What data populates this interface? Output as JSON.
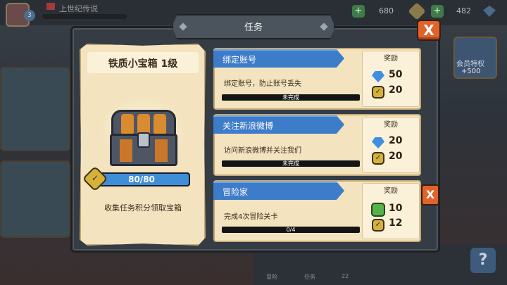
{
  "modal": {
    "title": "任务",
    "close_label": "X"
  },
  "chest": {
    "title": "铁质小宝箱 1级",
    "progress_text": "80/80",
    "progress_fraction": 1.0,
    "description": "收集任务积分领取宝箱"
  },
  "tasks": [
    {
      "name": "绑定账号",
      "description": "绑定账号，防止账号丢失",
      "status_text": "未完成",
      "progress_fraction": 0.0,
      "reward_label": "奖励",
      "rewards": [
        {
          "icon": "gem-icon",
          "value": "50"
        },
        {
          "icon": "coin-icon",
          "value": "20"
        }
      ]
    },
    {
      "name": "关注新浪微博",
      "description": "访问新浪微博并关注我们",
      "status_text": "未完成",
      "progress_fraction": 0.0,
      "reward_label": "奖励",
      "rewards": [
        {
          "icon": "gem-icon",
          "value": "20"
        },
        {
          "icon": "coin-icon",
          "value": "20"
        }
      ]
    },
    {
      "name": "冒险家",
      "description": "完成4次冒险关卡",
      "status_text": "0/4",
      "progress_fraction": 0.0,
      "reward_label": "奖励",
      "rewards": [
        {
          "icon": "green-token-icon",
          "value": "10"
        },
        {
          "icon": "coin-icon",
          "value": "12"
        }
      ]
    }
  ],
  "task3_side_button": "X",
  "background": {
    "player_name": "上世纪传说",
    "player_level": "3",
    "resource_1": "680",
    "resource_2": "482",
    "side_card_label": "会员特权",
    "side_card_value": "+500",
    "help_icon_label": "?",
    "nav_labels": [
      "冒险",
      "任务",
      "22"
    ]
  },
  "colors": {
    "accent_blue": "#3d7cc9",
    "parchment": "#f3e3bf",
    "close_orange": "#e0642a",
    "progress_blue": "#3f8ed8"
  }
}
